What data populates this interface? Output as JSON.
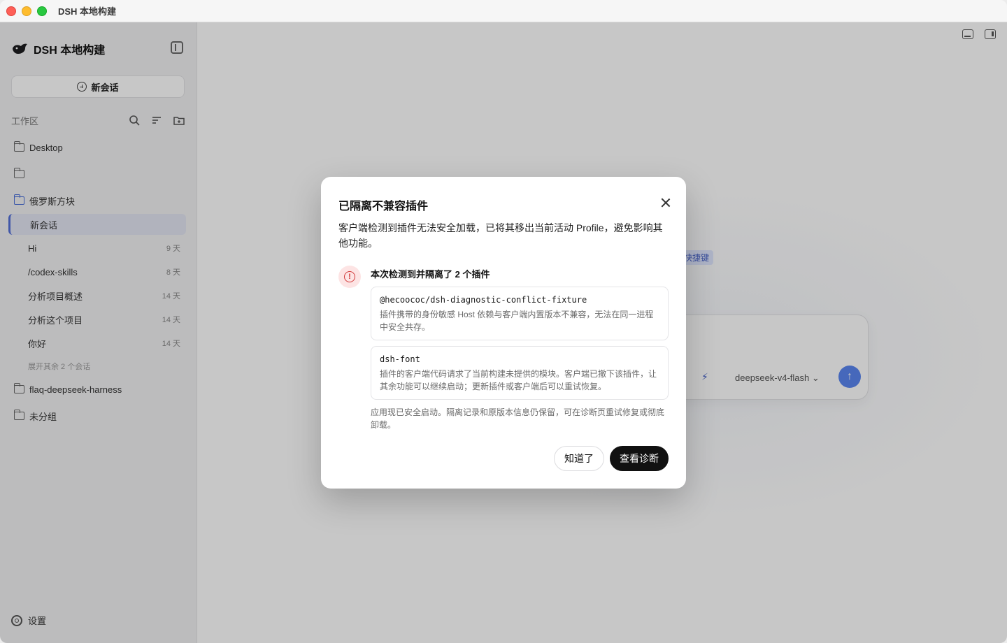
{
  "window": {
    "title": "DSH 本地构建"
  },
  "sidebar": {
    "brand": "DSH 本地构建",
    "new_chat_label": "新会话",
    "workspace_label": "工作区",
    "tree": [
      {
        "name": "Desktop",
        "type": "folder"
      },
      {
        "name": "",
        "type": "folder"
      },
      {
        "name": "俄罗斯方块",
        "type": "folder-open"
      }
    ],
    "chats": [
      {
        "title": "新会话",
        "time": "",
        "active": true
      },
      {
        "title": "Hi",
        "time": "9 天",
        "active": false
      },
      {
        "title": "/codex-skills",
        "time": "8 天",
        "active": false
      },
      {
        "title": "分析项目概述",
        "time": "14 天",
        "active": false
      },
      {
        "title": "分析这个项目",
        "time": "14 天",
        "active": false
      },
      {
        "title": "你好",
        "time": "14 天",
        "active": false
      }
    ],
    "more_chats": "展开其余 2 个会话",
    "tree_bottom": [
      {
        "name": "flaq-deepseek-harness",
        "type": "folder"
      },
      {
        "name": "未分组",
        "type": "folder"
      }
    ],
    "settings_label": "设置"
  },
  "main": {
    "chip_label": "快捷键",
    "model_select": "deepseek-v4-flash"
  },
  "modal": {
    "title": "已隔离不兼容插件",
    "description": "客户端检测到插件无法安全加载，已将其移出当前活动 Profile，避免影响其他功能。",
    "summary": "本次检测到并隔离了 2 个插件",
    "plugins": [
      {
        "name": "@hecoococ/dsh-diagnostic-conflict-fixture",
        "reason": "插件携带的身份敏感 Host 依赖与客户端内置版本不兼容，无法在同一进程中安全共存。"
      },
      {
        "name": "dsh-font",
        "reason": "插件的客户端代码请求了当前构建未提供的模块。客户端已撤下该插件，让其余功能可以继续启动；更新插件或客户端后可以重试恢复。"
      }
    ],
    "footnote": "应用现已安全启动。隔离记录和原版本信息仍保留，可在诊断页重试修复或彻底卸载。",
    "ack_label": "知道了",
    "diagnose_label": "查看诊断"
  },
  "colors": {
    "accent": "#5470d8",
    "danger": "#d23b3b",
    "primary_button": "#111111"
  }
}
